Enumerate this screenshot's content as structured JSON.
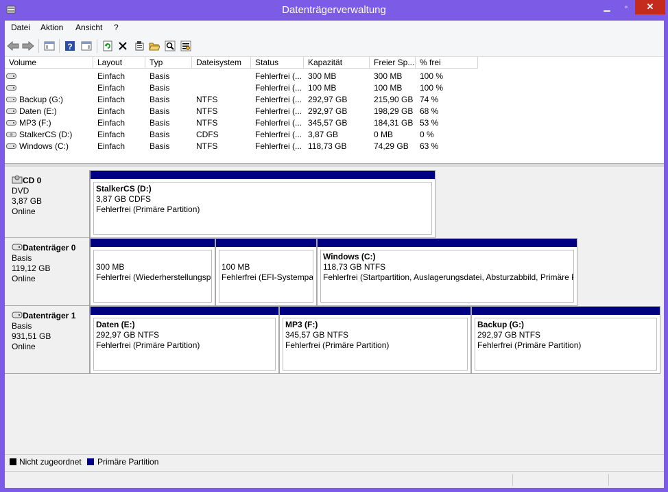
{
  "window": {
    "title": "Datenträgerverwaltung",
    "minimize": "▁",
    "maximize": "▫",
    "close": "✕"
  },
  "menu": [
    "Datei",
    "Aktion",
    "Ansicht",
    "?"
  ],
  "columns": [
    "Volume",
    "Layout",
    "Typ",
    "Dateisystem",
    "Status",
    "Kapazität",
    "Freier Sp...",
    "% frei"
  ],
  "volumes": [
    {
      "name": "",
      "layout": "Einfach",
      "type": "Basis",
      "fs": "",
      "status": "Fehlerfrei (...",
      "capacity": "300 MB",
      "free": "300 MB",
      "pct": "100 %"
    },
    {
      "name": "",
      "layout": "Einfach",
      "type": "Basis",
      "fs": "",
      "status": "Fehlerfrei (...",
      "capacity": "100 MB",
      "free": "100 MB",
      "pct": "100 %"
    },
    {
      "name": "Backup (G:)",
      "layout": "Einfach",
      "type": "Basis",
      "fs": "NTFS",
      "status": "Fehlerfrei (...",
      "capacity": "292,97 GB",
      "free": "215,90 GB",
      "pct": "74 %"
    },
    {
      "name": "Daten (E:)",
      "layout": "Einfach",
      "type": "Basis",
      "fs": "NTFS",
      "status": "Fehlerfrei (...",
      "capacity": "292,97 GB",
      "free": "198,29 GB",
      "pct": "68 %"
    },
    {
      "name": "MP3 (F:)",
      "layout": "Einfach",
      "type": "Basis",
      "fs": "NTFS",
      "status": "Fehlerfrei (...",
      "capacity": "345,57 GB",
      "free": "184,31 GB",
      "pct": "53 %"
    },
    {
      "name": "StalkerCS (D:)",
      "layout": "Einfach",
      "type": "Basis",
      "fs": "CDFS",
      "status": "Fehlerfrei (...",
      "capacity": "3,87 GB",
      "free": "0 MB",
      "pct": "0 %"
    },
    {
      "name": "Windows (C:)",
      "layout": "Einfach",
      "type": "Basis",
      "fs": "NTFS",
      "status": "Fehlerfrei (...",
      "capacity": "118,73 GB",
      "free": "74,29 GB",
      "pct": "63 %"
    }
  ],
  "disks": [
    {
      "name": "CD 0",
      "type": "DVD",
      "size": "3,87 GB",
      "state": "Online",
      "partitions": [
        {
          "name": "StalkerCS  (D:)",
          "size": "3,87 GB CDFS",
          "status": "Fehlerfrei (Primäre Partition)"
        }
      ]
    },
    {
      "name": "Datenträger 0",
      "type": "Basis",
      "size": "119,12 GB",
      "state": "Online",
      "partitions": [
        {
          "name": "",
          "size": "300 MB",
          "status": "Fehlerfrei (Wiederherstellungspartition)"
        },
        {
          "name": "",
          "size": "100 MB",
          "status": "Fehlerfrei (EFI-Systempartition)"
        },
        {
          "name": "Windows  (C:)",
          "size": "118,73 GB NTFS",
          "status": "Fehlerfrei (Startpartition, Auslagerungsdatei, Absturzabbild, Primäre Partition)"
        }
      ]
    },
    {
      "name": "Datenträger 1",
      "type": "Basis",
      "size": "931,51 GB",
      "state": "Online",
      "partitions": [
        {
          "name": "Daten  (E:)",
          "size": "292,97 GB NTFS",
          "status": "Fehlerfrei (Primäre Partition)"
        },
        {
          "name": "MP3  (F:)",
          "size": "345,57 GB NTFS",
          "status": "Fehlerfrei (Primäre Partition)"
        },
        {
          "name": "Backup  (G:)",
          "size": "292,97 GB NTFS",
          "status": "Fehlerfrei (Primäre Partition)"
        }
      ]
    }
  ],
  "legend": [
    {
      "label": "Nicht zugeordnet",
      "color": "#000000"
    },
    {
      "label": "Primäre Partition",
      "color": "#000080"
    }
  ],
  "colors": {
    "title_bar": "#7c5ce6",
    "partition_bar": "#000080",
    "close_button": "#c42b1c"
  }
}
